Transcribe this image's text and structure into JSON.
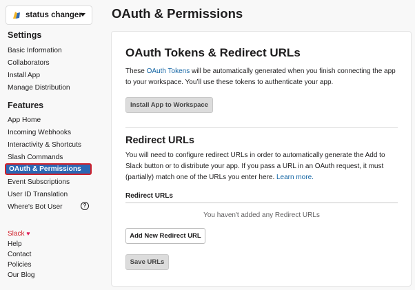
{
  "sidebar": {
    "app_name": "status changer",
    "settings_title": "Settings",
    "settings_items": [
      "Basic Information",
      "Collaborators",
      "Install App",
      "Manage Distribution"
    ],
    "features_title": "Features",
    "features_items": [
      "App Home",
      "Incoming Webhooks",
      "Interactivity & Shortcuts",
      "Slash Commands",
      "OAuth & Permissions",
      "Event Subscriptions",
      "User ID Translation",
      "Where's Bot User"
    ],
    "help_glyph": "?",
    "footer": {
      "slack": "Slack",
      "heart": "♥",
      "links": [
        "Help",
        "Contact",
        "Policies",
        "Our Blog"
      ]
    }
  },
  "main": {
    "page_title": "OAuth & Permissions",
    "tokens": {
      "title": "OAuth Tokens & Redirect URLs",
      "desc_pre": "These ",
      "desc_link": "OAuth Tokens",
      "desc_post": " will be automatically generated when you finish connecting the app to your workspace. You’ll use these tokens to authenticate your app.",
      "install_button": "Install App to Workspace"
    },
    "redirect": {
      "title": "Redirect URLs",
      "desc": "You will need to configure redirect URLs in order to automatically generate the Add to Slack button or to distribute your app. If you pass a URL in an OAuth request, it must (partially) match one of the URLs you enter here. ",
      "desc_link": "Learn more.",
      "label": "Redirect URLs",
      "empty": "You haven't added any Redirect URLs",
      "add_button": "Add New Redirect URL",
      "save_button": "Save URLs"
    }
  }
}
